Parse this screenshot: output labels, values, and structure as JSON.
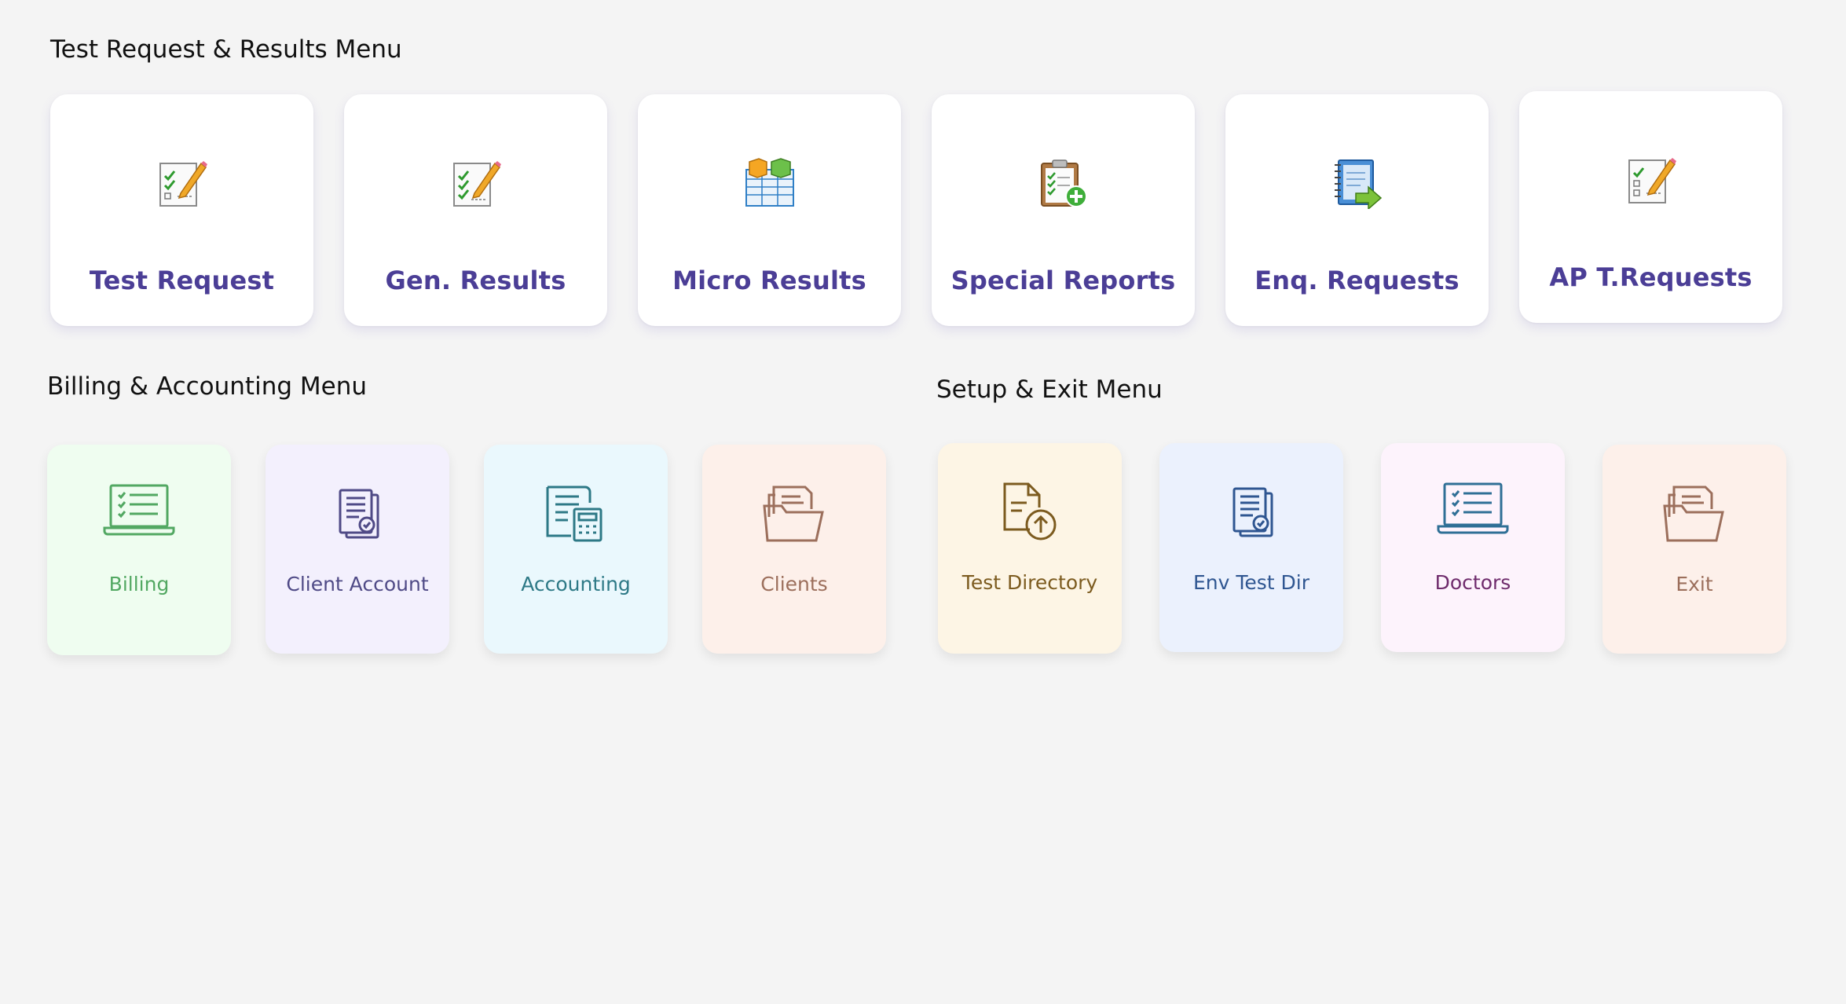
{
  "sections": {
    "test": "Test Request & Results Menu",
    "billing": "Billing & Accounting Menu",
    "setup": "Setup & Exit Menu"
  },
  "test_cards": [
    {
      "label": "Test Request",
      "icon": "checklist-pencil-icon"
    },
    {
      "label": "Gen. Results",
      "icon": "checklist-pencil-icon"
    },
    {
      "label": "Micro Results",
      "icon": "spreadsheet-boxes-icon"
    },
    {
      "label": "Special Reports",
      "icon": "clipboard-add-icon"
    },
    {
      "label": "Enq. Requests",
      "icon": "notebook-arrow-icon"
    },
    {
      "label": "AP T.Requests",
      "icon": "checklist-pencil-icon"
    }
  ],
  "billing_cards": [
    {
      "label": "Billing",
      "icon": "laptop-checklist-icon",
      "bg": "#effdf0",
      "color": "#52a862"
    },
    {
      "label": "Client Account",
      "icon": "documents-check-icon",
      "bg": "#f3f0fd",
      "color": "#4f4a86"
    },
    {
      "label": "Accounting",
      "icon": "document-calculator-icon",
      "bg": "#eaf8fd",
      "color": "#2d7986"
    },
    {
      "label": "Clients",
      "icon": "folder-documents-icon",
      "bg": "#fdf0ea",
      "color": "#9c6f5c"
    }
  ],
  "setup_cards": [
    {
      "label": "Test Directory",
      "icon": "document-upload-icon",
      "bg": "#fdf5e5",
      "color": "#7c5b1f"
    },
    {
      "label": "Env Test Dir",
      "icon": "documents-check-icon",
      "bg": "#ebf1fd",
      "color": "#2f5691"
    },
    {
      "label": "Doctors",
      "icon": "laptop-checklist-icon",
      "bg": "#fdf3fc",
      "color": "#6f2b6c"
    },
    {
      "label": "Exit",
      "icon": "folder-documents-icon",
      "bg": "#fdf0ea",
      "color": "#9c6f5c"
    }
  ]
}
